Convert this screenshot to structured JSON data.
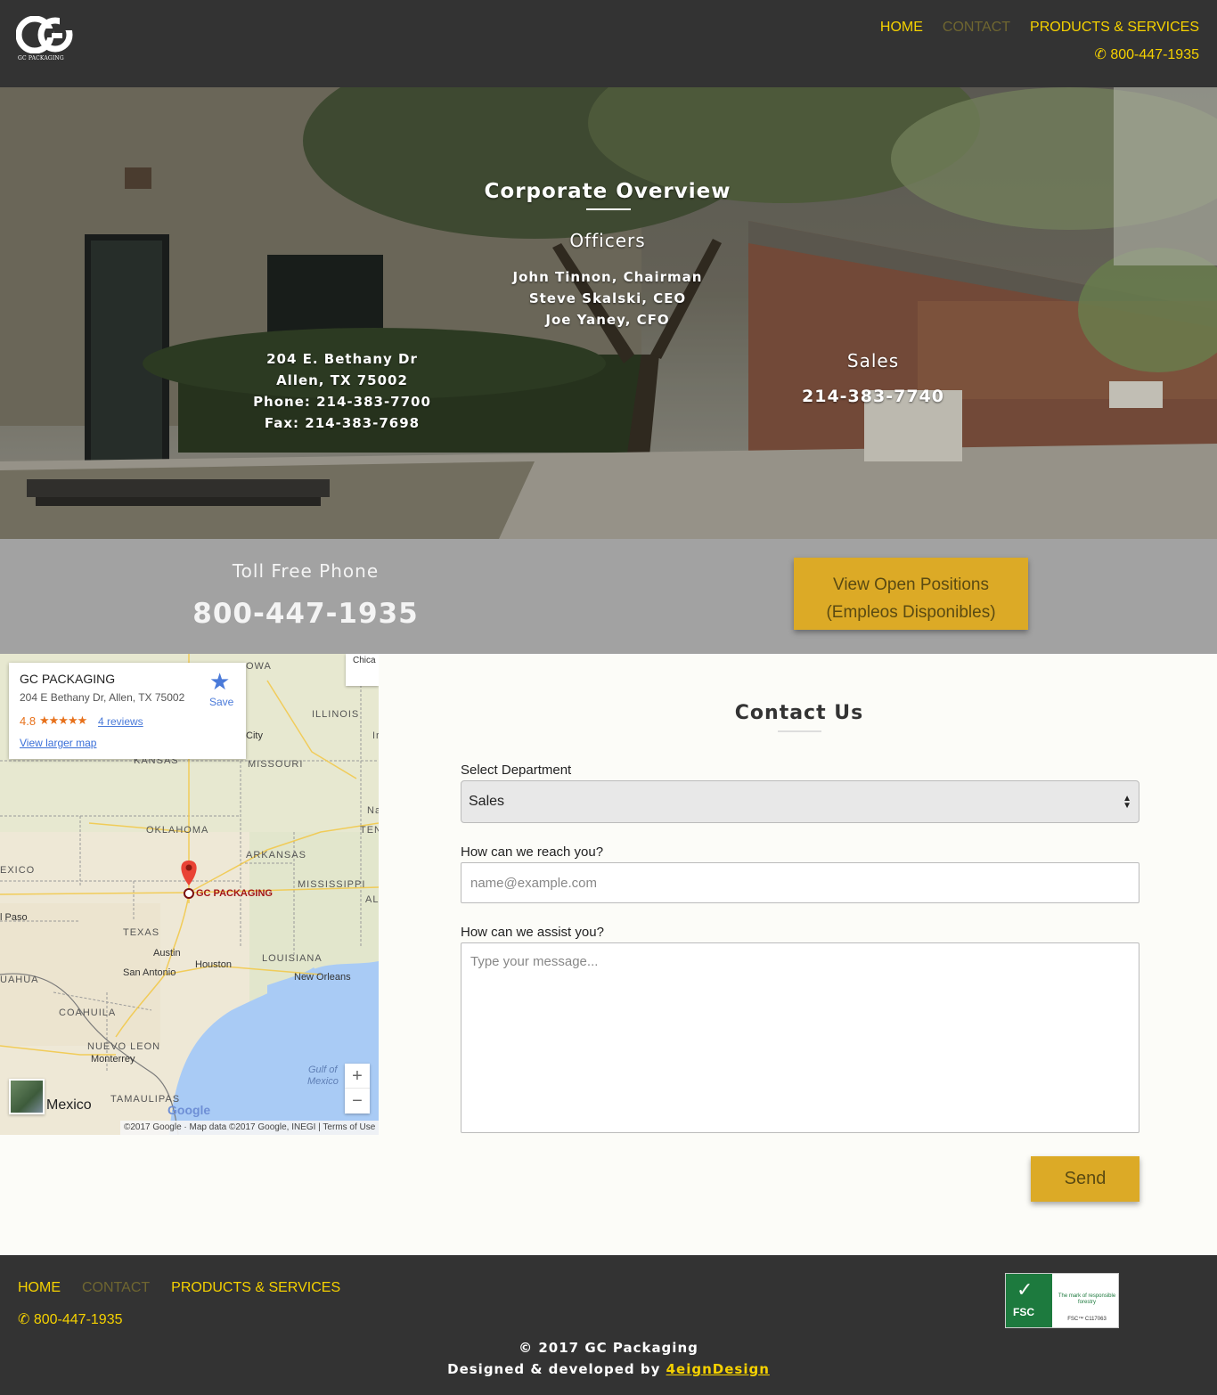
{
  "header": {
    "logo_text": "GC PACKAGING",
    "nav": [
      {
        "label": "HOME",
        "current": false
      },
      {
        "label": "CONTACT",
        "current": true
      },
      {
        "label": "PRODUCTS & SERVICES",
        "current": false
      }
    ],
    "phone": "800-447-1935"
  },
  "hero": {
    "title": "Corporate Overview",
    "officers_heading": "Officers",
    "officers": [
      "John Tinnon, Chairman",
      "Steve Skalski, CEO",
      "Joe Yaney, CFO"
    ],
    "address": [
      "204 E. Bethany Dr",
      "Allen, TX 75002",
      "Phone: 214-383-7700",
      "Fax: 214-383-7698"
    ],
    "sales_heading": "Sales",
    "sales_phone": "214-383-7740"
  },
  "toll_free": {
    "label": "Toll Free Phone",
    "number": "800-447-1935",
    "positions_button_line1": "View Open Positions",
    "positions_button_line2": "(Empleos Disponibles)"
  },
  "map": {
    "card": {
      "name": "GC PACKAGING",
      "address": "204 E Bethany Dr, Allen, TX 75002",
      "rating": "4.8",
      "stars": "★★★★★",
      "reviews": "4 reviews",
      "larger_map": "View larger map",
      "save": "Save"
    },
    "pin_label": "GC PACKAGING",
    "labels": {
      "iowa": "OWA",
      "chicago": "Chica",
      "illinois": "ILLINOIS",
      "city": "City",
      "il": "Ir",
      "kansas": "KANSAS",
      "missouri": "MISSOURI",
      "na": "Na",
      "oklahoma": "OKLAHOMA",
      "ten": "TEN",
      "arkansas": "ARKANSAS",
      "mexico_state": "EXICO",
      "mississippi": "MISSISSIPPI",
      "al": "AL",
      "el_paso": "l Paso",
      "texas": "TEXAS",
      "austin": "Austin",
      "houston": "Houston",
      "louisiana": "LOUISIANA",
      "san_antonio": "San Antonio",
      "new_orleans": "New Orleans",
      "chihuahua": "UAHUA",
      "coahuila": "COAHUILA",
      "nuevo_leon": "NUEVO LEON",
      "monterrey": "Monterrey",
      "gulf": "Gulf of",
      "gulf2": "Mexico",
      "tamaulipas": "TAMAULIPAS"
    },
    "thumb_label": "Mexico",
    "google": "Google",
    "attribution": "©2017 Google · Map data ©2017 Google, INEGI  |  Terms of Use",
    "zoom_in": "+",
    "zoom_out": "−"
  },
  "contact": {
    "title": "Contact Us",
    "department_label": "Select Department",
    "department_value": "Sales",
    "reach_label": "How can we reach you?",
    "reach_placeholder": "name@example.com",
    "assist_label": "How can we assist you?",
    "assist_placeholder": "Type your message...",
    "send": "Send"
  },
  "footer": {
    "nav": [
      {
        "label": "HOME",
        "current": false
      },
      {
        "label": "CONTACT",
        "current": true
      },
      {
        "label": "PRODUCTS & SERVICES",
        "current": false
      }
    ],
    "phone": "800-447-1935",
    "fsc": {
      "brand": "FSC",
      "mark": "The mark of responsible forestry",
      "code": "FSC™ C117063"
    },
    "copyright": "© 2017 GC Packaging",
    "designed_prefix": "Designed & developed by ",
    "designer": "4eignDesign"
  },
  "colors": {
    "accent_yellow": "#f5d100",
    "button_gold": "#dcaa26",
    "dark_bg": "#333333",
    "band_gray": "#a2a2a2"
  },
  "icons": {
    "phone": "phone-icon",
    "save": "star-icon",
    "pin": "map-pin-icon"
  }
}
